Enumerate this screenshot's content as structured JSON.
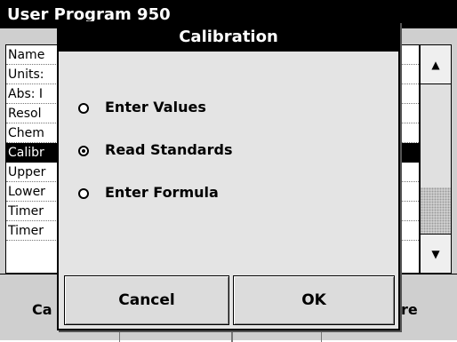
{
  "background": {
    "title": "User Program   950",
    "list_items": [
      "Name",
      "Units:",
      "Abs: I",
      "Resol",
      "Chem",
      "Calibr",
      "Upper",
      "Lower",
      "Timer",
      "Timer"
    ],
    "selected_index": 5,
    "bottom_left_label": "Ca",
    "bottom_right_label": "ore",
    "scroll_up_icon": "arrow-up",
    "scroll_down_icon": "arrow-down"
  },
  "dialog": {
    "title": "Calibration",
    "options": [
      {
        "label": "Enter Values",
        "selected": false
      },
      {
        "label": "Read Standards",
        "selected": true
      },
      {
        "label": "Enter Formula",
        "selected": false
      }
    ],
    "cancel_label": "Cancel",
    "ok_label": "OK"
  },
  "colors": {
    "title_bar": "#000000",
    "dialog_bg": "#e4e4e4",
    "selection": "#000000"
  }
}
